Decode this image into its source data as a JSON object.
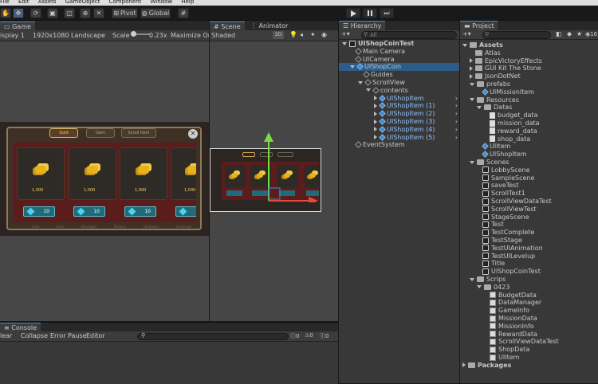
{
  "menu": [
    "File",
    "Edit",
    "Assets",
    "GameObject",
    "Component",
    "Window",
    "Help"
  ],
  "toolbar": {
    "pivot": "Pivot",
    "global": "Global"
  },
  "game": {
    "tab": "Game",
    "display": "isplay 1",
    "resolution": "1920x1080 Landscape",
    "scale_label": "Scale",
    "scale_value": "0.23x",
    "maximize": "Maximize On"
  },
  "shop": {
    "tabs": [
      "Gold",
      "Gem",
      "Scroll Item"
    ],
    "amount": "1,000",
    "price": "10",
    "categories": [
      "Gold",
      "Gem",
      "Messages",
      "Stickers",
      "Hardware",
      "Greetings"
    ]
  },
  "scene": {
    "tab": "Scene",
    "animator_tab": "Animator",
    "shading": "Shaded",
    "mode": "2D"
  },
  "console": {
    "tab": "Console",
    "clear": "lear",
    "collapse": "Collapse",
    "error_pause": "Error Pause",
    "editor": "Editor",
    "count_err": "0",
    "count_warn": "0",
    "count_log": "0"
  },
  "hierarchy": {
    "tab": "Hierarchy",
    "search": "All",
    "items": [
      {
        "label": "UIShopCoinTest",
        "indent": 0,
        "kind": "scene",
        "arrow": "down",
        "bold": true
      },
      {
        "label": "Main Camera",
        "indent": 1,
        "kind": "cube"
      },
      {
        "label": "UICamera",
        "indent": 1,
        "kind": "cube"
      },
      {
        "label": "UIShopCoin",
        "indent": 1,
        "kind": "blue",
        "arrow": "down",
        "selected": true
      },
      {
        "label": "Guides",
        "indent": 2,
        "kind": "cube"
      },
      {
        "label": "ScrollView",
        "indent": 2,
        "kind": "cube",
        "arrow": "down"
      },
      {
        "label": "contents",
        "indent": 3,
        "kind": "cube",
        "arrow": "down"
      },
      {
        "label": "UIShopItem",
        "indent": 4,
        "kind": "blue",
        "arrow": "right",
        "blue": true,
        "chev": true
      },
      {
        "label": "UIShopItem (1)",
        "indent": 4,
        "kind": "blue",
        "arrow": "right",
        "blue": true,
        "chev": true
      },
      {
        "label": "UIShopItem (2)",
        "indent": 4,
        "kind": "blue",
        "arrow": "right",
        "blue": true,
        "chev": true
      },
      {
        "label": "UIShopItem (3)",
        "indent": 4,
        "kind": "blue",
        "arrow": "right",
        "blue": true,
        "chev": true
      },
      {
        "label": "UIShopItem (4)",
        "indent": 4,
        "kind": "blue",
        "arrow": "right",
        "blue": true,
        "chev": true
      },
      {
        "label": "UIShopItem (5)",
        "indent": 4,
        "kind": "blue",
        "arrow": "right",
        "blue": true,
        "chev": true
      },
      {
        "label": "EventSystem",
        "indent": 1,
        "kind": "cube"
      }
    ]
  },
  "project": {
    "tab": "Project",
    "count": "16",
    "items": [
      {
        "label": "Assets",
        "indent": 0,
        "kind": "folder",
        "arrow": "down",
        "bold": true
      },
      {
        "label": "Atlas",
        "indent": 1,
        "kind": "folder"
      },
      {
        "label": "EpicVictoryEffects",
        "indent": 1,
        "kind": "folder",
        "arrow": "right"
      },
      {
        "label": "GUI Kit The Stone",
        "indent": 1,
        "kind": "folder",
        "arrow": "right"
      },
      {
        "label": "JsonDotNet",
        "indent": 1,
        "kind": "folder",
        "arrow": "right"
      },
      {
        "label": "prefabs",
        "indent": 1,
        "kind": "folder",
        "arrow": "down"
      },
      {
        "label": "UIMissionItem",
        "indent": 2,
        "kind": "blue"
      },
      {
        "label": "Resources",
        "indent": 1,
        "kind": "folder",
        "arrow": "down"
      },
      {
        "label": "Datas",
        "indent": 2,
        "kind": "folder",
        "arrow": "down"
      },
      {
        "label": "budget_data",
        "indent": 3,
        "kind": "file"
      },
      {
        "label": "mission_data",
        "indent": 3,
        "kind": "file"
      },
      {
        "label": "reward_data",
        "indent": 3,
        "kind": "file"
      },
      {
        "label": "shop_data",
        "indent": 3,
        "kind": "file"
      },
      {
        "label": "UIItem",
        "indent": 2,
        "kind": "blue"
      },
      {
        "label": "UIShopItem",
        "indent": 2,
        "kind": "blue"
      },
      {
        "label": "Scenes",
        "indent": 1,
        "kind": "folder",
        "arrow": "down"
      },
      {
        "label": "LobbyScene",
        "indent": 2,
        "kind": "unity"
      },
      {
        "label": "SampleScene",
        "indent": 2,
        "kind": "unity"
      },
      {
        "label": "saveTest",
        "indent": 2,
        "kind": "unity"
      },
      {
        "label": "ScrollTest1",
        "indent": 2,
        "kind": "unity"
      },
      {
        "label": "ScrollViewDataTest",
        "indent": 2,
        "kind": "unity"
      },
      {
        "label": "ScrollViewTest",
        "indent": 2,
        "kind": "unity"
      },
      {
        "label": "StageScene",
        "indent": 2,
        "kind": "unity"
      },
      {
        "label": "Test",
        "indent": 2,
        "kind": "unity"
      },
      {
        "label": "TestComplete",
        "indent": 2,
        "kind": "unity"
      },
      {
        "label": "TestStage",
        "indent": 2,
        "kind": "unity"
      },
      {
        "label": "TestUIAnimation",
        "indent": 2,
        "kind": "unity"
      },
      {
        "label": "TestUILevelup",
        "indent": 2,
        "kind": "unity"
      },
      {
        "label": "Title",
        "indent": 2,
        "kind": "unity"
      },
      {
        "label": "UIShopCoinTest",
        "indent": 2,
        "kind": "unity"
      },
      {
        "label": "Scrips",
        "indent": 1,
        "kind": "folder",
        "arrow": "down"
      },
      {
        "label": "0423",
        "indent": 2,
        "kind": "folder",
        "arrow": "down"
      },
      {
        "label": "BudgetData",
        "indent": 3,
        "kind": "cs"
      },
      {
        "label": "DataManager",
        "indent": 3,
        "kind": "cs"
      },
      {
        "label": "GameInfo",
        "indent": 3,
        "kind": "cs"
      },
      {
        "label": "MissionData",
        "indent": 3,
        "kind": "cs"
      },
      {
        "label": "MissionInfo",
        "indent": 3,
        "kind": "cs"
      },
      {
        "label": "RewardData",
        "indent": 3,
        "kind": "cs"
      },
      {
        "label": "ScrollViewDataTest",
        "indent": 3,
        "kind": "cs"
      },
      {
        "label": "ShopData",
        "indent": 3,
        "kind": "cs"
      },
      {
        "label": "UIItem",
        "indent": 3,
        "kind": "cs"
      },
      {
        "label": "Packages",
        "indent": 0,
        "kind": "folder",
        "arrow": "right",
        "bold": true
      }
    ]
  }
}
